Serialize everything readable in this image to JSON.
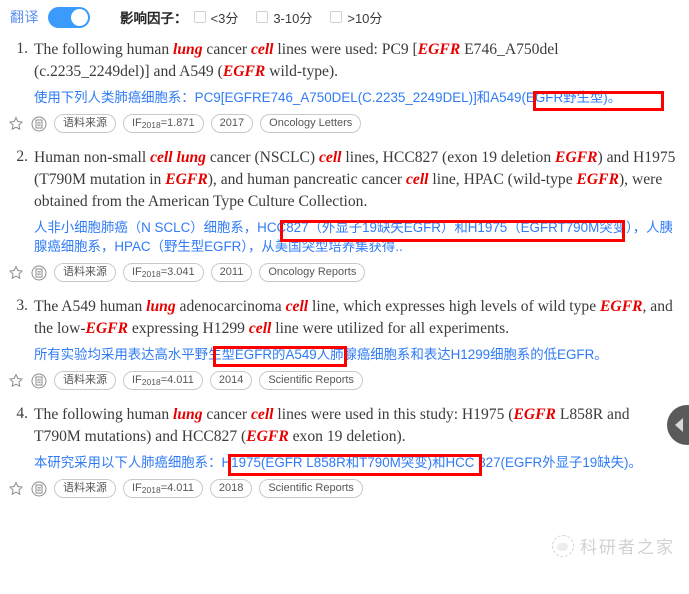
{
  "toolbar": {
    "translate_label": "翻译",
    "translate_on": true,
    "impact_factor_label": "影响因子：",
    "filters": [
      {
        "label": "<3分",
        "checked": false
      },
      {
        "label": "3-10分",
        "checked": false
      },
      {
        "label": ">10分",
        "checked": false
      }
    ]
  },
  "colors": {
    "accent_blue": "#3a9bfc",
    "translation_blue": "#2f7bf6",
    "keyword_red": "#e60000",
    "highlight_box_red": "#ff0000",
    "english_text": "#3b3b3b"
  },
  "results": [
    {
      "index": "1.",
      "english_parts": [
        {
          "t": "The following human ",
          "kw": false
        },
        {
          "t": "lung",
          "kw": true
        },
        {
          "t": " cancer ",
          "kw": false
        },
        {
          "t": "cell",
          "kw": true
        },
        {
          "t": " lines were used: PC9 [",
          "kw": false
        },
        {
          "t": "EGFR",
          "kw": true
        },
        {
          "t": " E746_A750del (c.2235_2249del)] and A549 (",
          "kw": false
        },
        {
          "t": "EGFR",
          "kw": true
        },
        {
          "t": " wild-type).",
          "kw": false
        }
      ],
      "translation": "使用下列人类肺癌细胞系：PC9[EGFRE746_A750DEL(C.2235_2249DEL)]和A549(EGFR野生型)。",
      "highlight": "A549(EGFR野生型)",
      "meta": {
        "star_icon": "star-icon",
        "doc_icon": "document-icon",
        "source_label": "语料来源",
        "if_prefix": "IF",
        "if_year": "2018",
        "if_value": "=1.871",
        "year": "2017",
        "journal": "Oncology Letters"
      }
    },
    {
      "index": "2.",
      "english_parts": [
        {
          "t": "Human non-small ",
          "kw": false
        },
        {
          "t": "cell lung",
          "kw": true
        },
        {
          "t": " cancer (NSCLC) ",
          "kw": false
        },
        {
          "t": "cell",
          "kw": true
        },
        {
          "t": " lines, HCC827 (exon 19 deletion ",
          "kw": false
        },
        {
          "t": "EGFR",
          "kw": true
        },
        {
          "t": ") and H1975 (T790M mutation in ",
          "kw": false
        },
        {
          "t": "EGFR",
          "kw": true
        },
        {
          "t": "), and human pancreatic cancer ",
          "kw": false
        },
        {
          "t": "cell",
          "kw": true
        },
        {
          "t": " line, HPAC (wild-type ",
          "kw": false
        },
        {
          "t": "EGFR",
          "kw": true
        },
        {
          "t": "), were obtained from the American Type Culture Collection.",
          "kw": false
        }
      ],
      "translation": "人非小细胞肺癌（N SCLC）细胞系，HCC827（外显子19缺失EGFR）和H1975（EGFRT790M突变），人胰腺癌细胞系，HPAC（野生型EGFR），从美国突型培养集获得..",
      "highlight": "HCC827（外显子19缺失EGFR）和H1975（EGFRT790M突变）",
      "meta": {
        "star_icon": "star-icon",
        "doc_icon": "document-icon",
        "source_label": "语料来源",
        "if_prefix": "IF",
        "if_year": "2018",
        "if_value": "=3.041",
        "year": "2011",
        "journal": "Oncology Reports"
      }
    },
    {
      "index": "3.",
      "english_parts": [
        {
          "t": "The A549 human ",
          "kw": false
        },
        {
          "t": "lung",
          "kw": true
        },
        {
          "t": " adenocarcinoma ",
          "kw": false
        },
        {
          "t": "cell",
          "kw": true
        },
        {
          "t": " line, which expresses high levels of wild type ",
          "kw": false
        },
        {
          "t": "EGFR",
          "kw": true
        },
        {
          "t": ", and the low-",
          "kw": false
        },
        {
          "t": "EGFR",
          "kw": true
        },
        {
          "t": " expressing H1299 ",
          "kw": false
        },
        {
          "t": "cell",
          "kw": true
        },
        {
          "t": " line were utilized for all experiments.",
          "kw": false
        }
      ],
      "translation": "所有实验均采用表达高水平野生型EGFR的A549人肺腺癌细胞系和表达H1299细胞系的低EGFR。",
      "highlight": "野生型EGFR的A549",
      "meta": {
        "star_icon": "star-icon",
        "doc_icon": "document-icon",
        "source_label": "语料来源",
        "if_prefix": "IF",
        "if_year": "2018",
        "if_value": "=4.011",
        "year": "2014",
        "journal": "Scientific Reports"
      }
    },
    {
      "index": "4.",
      "english_parts": [
        {
          "t": "The following human ",
          "kw": false
        },
        {
          "t": "lung",
          "kw": true
        },
        {
          "t": " cancer ",
          "kw": false
        },
        {
          "t": "cell",
          "kw": true
        },
        {
          "t": " lines were used in this study: H1975 (",
          "kw": false
        },
        {
          "t": "EGFR",
          "kw": true
        },
        {
          "t": " L858R and T790M mutations) and HCC827 (",
          "kw": false
        },
        {
          "t": "EGFR",
          "kw": true
        },
        {
          "t": " exon 19 deletion).",
          "kw": false
        }
      ],
      "translation": "本研究采用以下人肺癌细胞系：H1975(EGFR L858R和T790M突变)和HCC 827(EGFR外显子19缺失)。",
      "highlight": "H1975(EGFR L858R和T790M突变)",
      "meta": {
        "star_icon": "star-icon",
        "doc_icon": "document-icon",
        "source_label": "语料来源",
        "if_prefix": "IF",
        "if_year": "2018",
        "if_value": "=4.011",
        "year": "2018",
        "journal": "Scientific Reports"
      }
    }
  ],
  "float_button": {
    "icon": "chevron-left-icon"
  },
  "watermark": {
    "text": "科研者之家",
    "logo": "cloud-logo-icon"
  }
}
